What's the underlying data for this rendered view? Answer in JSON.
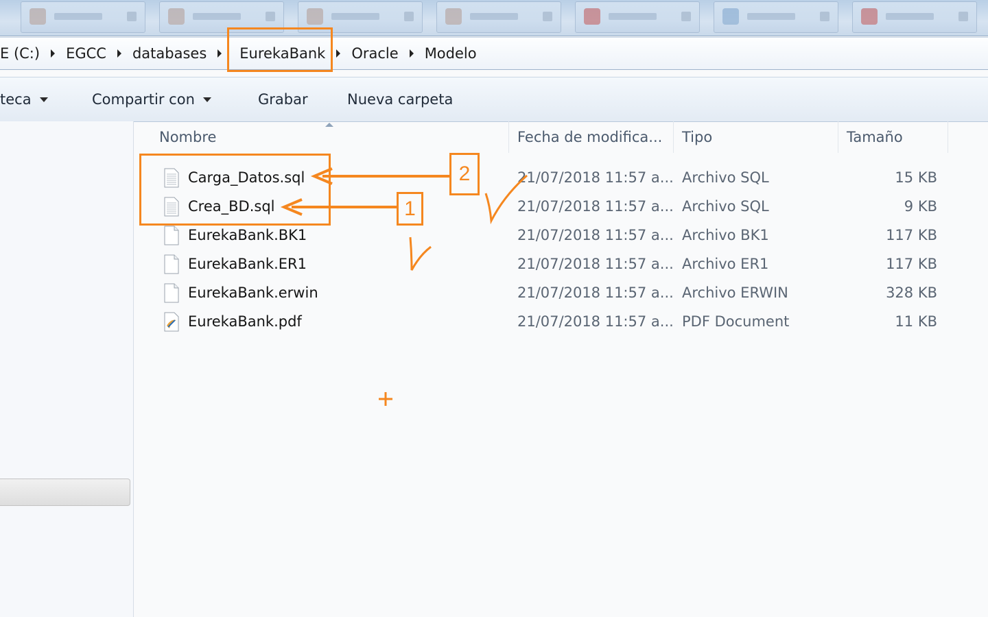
{
  "taskbar": {
    "buttons": 7
  },
  "address": {
    "crumbs": [
      "E (C:)",
      "EGCC",
      "databases",
      "EurekaBank",
      "Oracle",
      "Modelo"
    ]
  },
  "toolbar": {
    "library_label": "teca",
    "share_label": "Compartir con",
    "burn_label": "Grabar",
    "new_folder_label": "Nueva carpeta"
  },
  "columns": {
    "name": "Nombre",
    "date": "Fecha de modifica...",
    "type": "Tipo",
    "size": "Tamaño"
  },
  "files": [
    {
      "name": "Carga_Datos.sql",
      "date": "21/07/2018 11:57 a...",
      "type": "Archivo SQL",
      "size": "15 KB",
      "icon": "sql-file-icon"
    },
    {
      "name": "Crea_BD.sql",
      "date": "21/07/2018 11:57 a...",
      "type": "Archivo SQL",
      "size": "9 KB",
      "icon": "sql-file-icon"
    },
    {
      "name": "EurekaBank.BK1",
      "date": "21/07/2018 11:57 a...",
      "type": "Archivo BK1",
      "size": "117 KB",
      "icon": "blank-file-icon"
    },
    {
      "name": "EurekaBank.ER1",
      "date": "21/07/2018 11:57 a...",
      "type": "Archivo ER1",
      "size": "117 KB",
      "icon": "blank-file-icon"
    },
    {
      "name": "EurekaBank.erwin",
      "date": "21/07/2018 11:57 a...",
      "type": "Archivo ERWIN",
      "size": "328 KB",
      "icon": "blank-file-icon"
    },
    {
      "name": "EurekaBank.pdf",
      "date": "21/07/2018 11:57 a...",
      "type": "PDF Document",
      "size": "11 KB",
      "icon": "pdf-file-icon"
    }
  ],
  "annotations": {
    "step_1": "1",
    "step_2": "2",
    "color": "#f5871f"
  }
}
